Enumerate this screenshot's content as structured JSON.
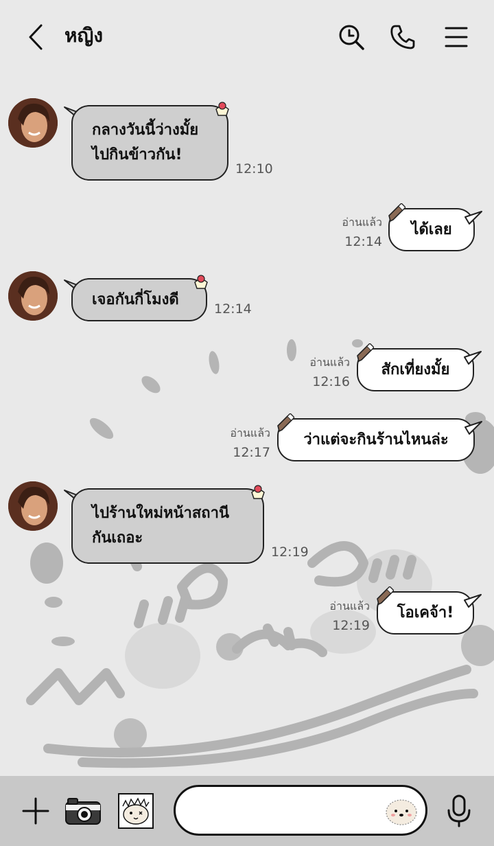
{
  "header": {
    "title": "หญิง",
    "back_icon": "chevron-left-icon",
    "search_icon": "search-icon",
    "call_icon": "phone-icon",
    "menu_icon": "hamburger-menu-icon"
  },
  "colors": {
    "background": "#e9e9e9",
    "incoming_bubble": "#cfcfcf",
    "outgoing_bubble": "#ffffff",
    "footer": "#c8c8c8",
    "doodle": "#b3b3b3"
  },
  "messages": [
    {
      "direction": "in",
      "text": "กลางวันนี้ว่างมั้ย\nไปกินข้าวกัน!",
      "time": "12:10"
    },
    {
      "direction": "out",
      "text": "ได้เลย",
      "read": "อ่านแล้ว",
      "time": "12:14"
    },
    {
      "direction": "in",
      "text": "เจอกันกี่โมงดี",
      "time": "12:14"
    },
    {
      "direction": "out",
      "text": "สักเที่ยงมั้ย",
      "read": "อ่านแล้ว",
      "time": "12:16"
    },
    {
      "direction": "out",
      "text": "ว่าแต่จะกินร้านไหนล่ะ",
      "read": "อ่านแล้ว",
      "time": "12:17"
    },
    {
      "direction": "in",
      "text": "ไปร้านใหม่หน้าสถานี\nกันเถอะ",
      "time": "12:19"
    },
    {
      "direction": "out",
      "text": "โอเคจ้า!",
      "read": "อ่านแล้ว",
      "time": "12:19"
    }
  ],
  "footer": {
    "plus_icon": "plus-icon",
    "camera_icon": "camera-icon",
    "sticker_icon": "sticker-icon",
    "emoji_icon": "emoji-icon",
    "mic_icon": "microphone-icon",
    "input_value": "",
    "input_placeholder": ""
  }
}
